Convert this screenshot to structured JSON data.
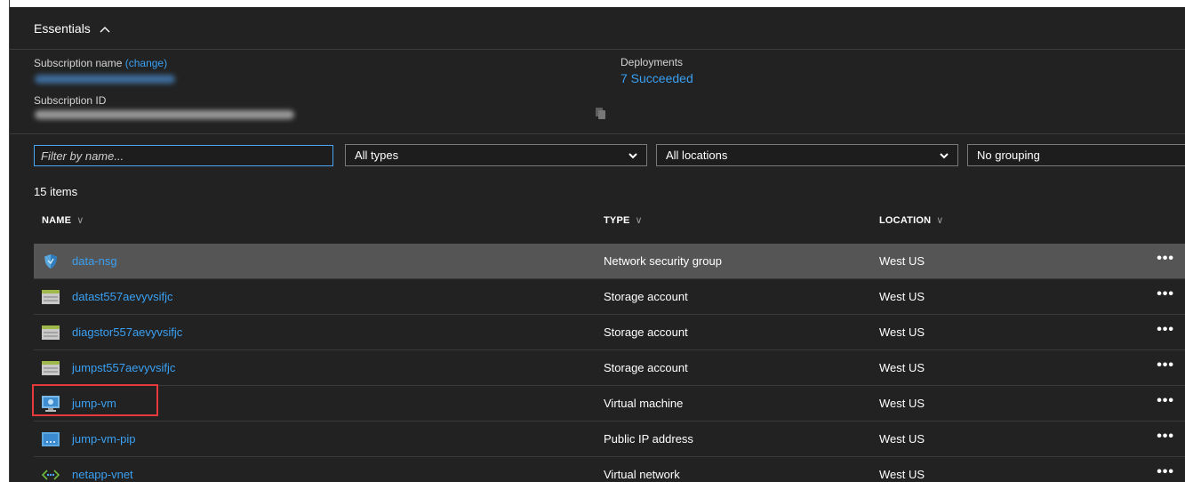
{
  "essentials": {
    "title": "Essentials",
    "subscription_name_label": "Subscription name",
    "change_link": "(change)",
    "subscription_id_label": "Subscription ID",
    "deployments_label": "Deployments",
    "deployments_value": "7 Succeeded"
  },
  "filters": {
    "name_placeholder": "Filter by name...",
    "types": "All types",
    "locations": "All locations",
    "grouping": "No grouping"
  },
  "count_text": "15 items",
  "columns": {
    "name": "NAME",
    "type": "TYPE",
    "location": "LOCATION"
  },
  "rows": [
    {
      "name": "data-nsg",
      "type": "Network security group",
      "location": "West US",
      "icon": "shield-icon",
      "selected": true
    },
    {
      "name": "datast557aevyvsifjc",
      "type": "Storage account",
      "location": "West US",
      "icon": "storage-account-icon"
    },
    {
      "name": "diagstor557aevyvsifjc",
      "type": "Storage account",
      "location": "West US",
      "icon": "storage-account-icon"
    },
    {
      "name": "jumpst557aevyvsifjc",
      "type": "Storage account",
      "location": "West US",
      "icon": "storage-account-icon"
    },
    {
      "name": "jump-vm",
      "type": "Virtual machine",
      "location": "West US",
      "icon": "virtual-machine-icon",
      "highlighted": true
    },
    {
      "name": "jump-vm-pip",
      "type": "Public IP address",
      "location": "West US",
      "icon": "public-ip-icon"
    },
    {
      "name": "netapp-vnet",
      "type": "Virtual network",
      "location": "West US",
      "icon": "virtual-network-icon"
    }
  ],
  "more_glyph": "•••",
  "colors": {
    "panel_bg": "#222222",
    "link": "#3aa0f3",
    "selected_row": "#555555",
    "highlight_border": "#e5393b"
  }
}
